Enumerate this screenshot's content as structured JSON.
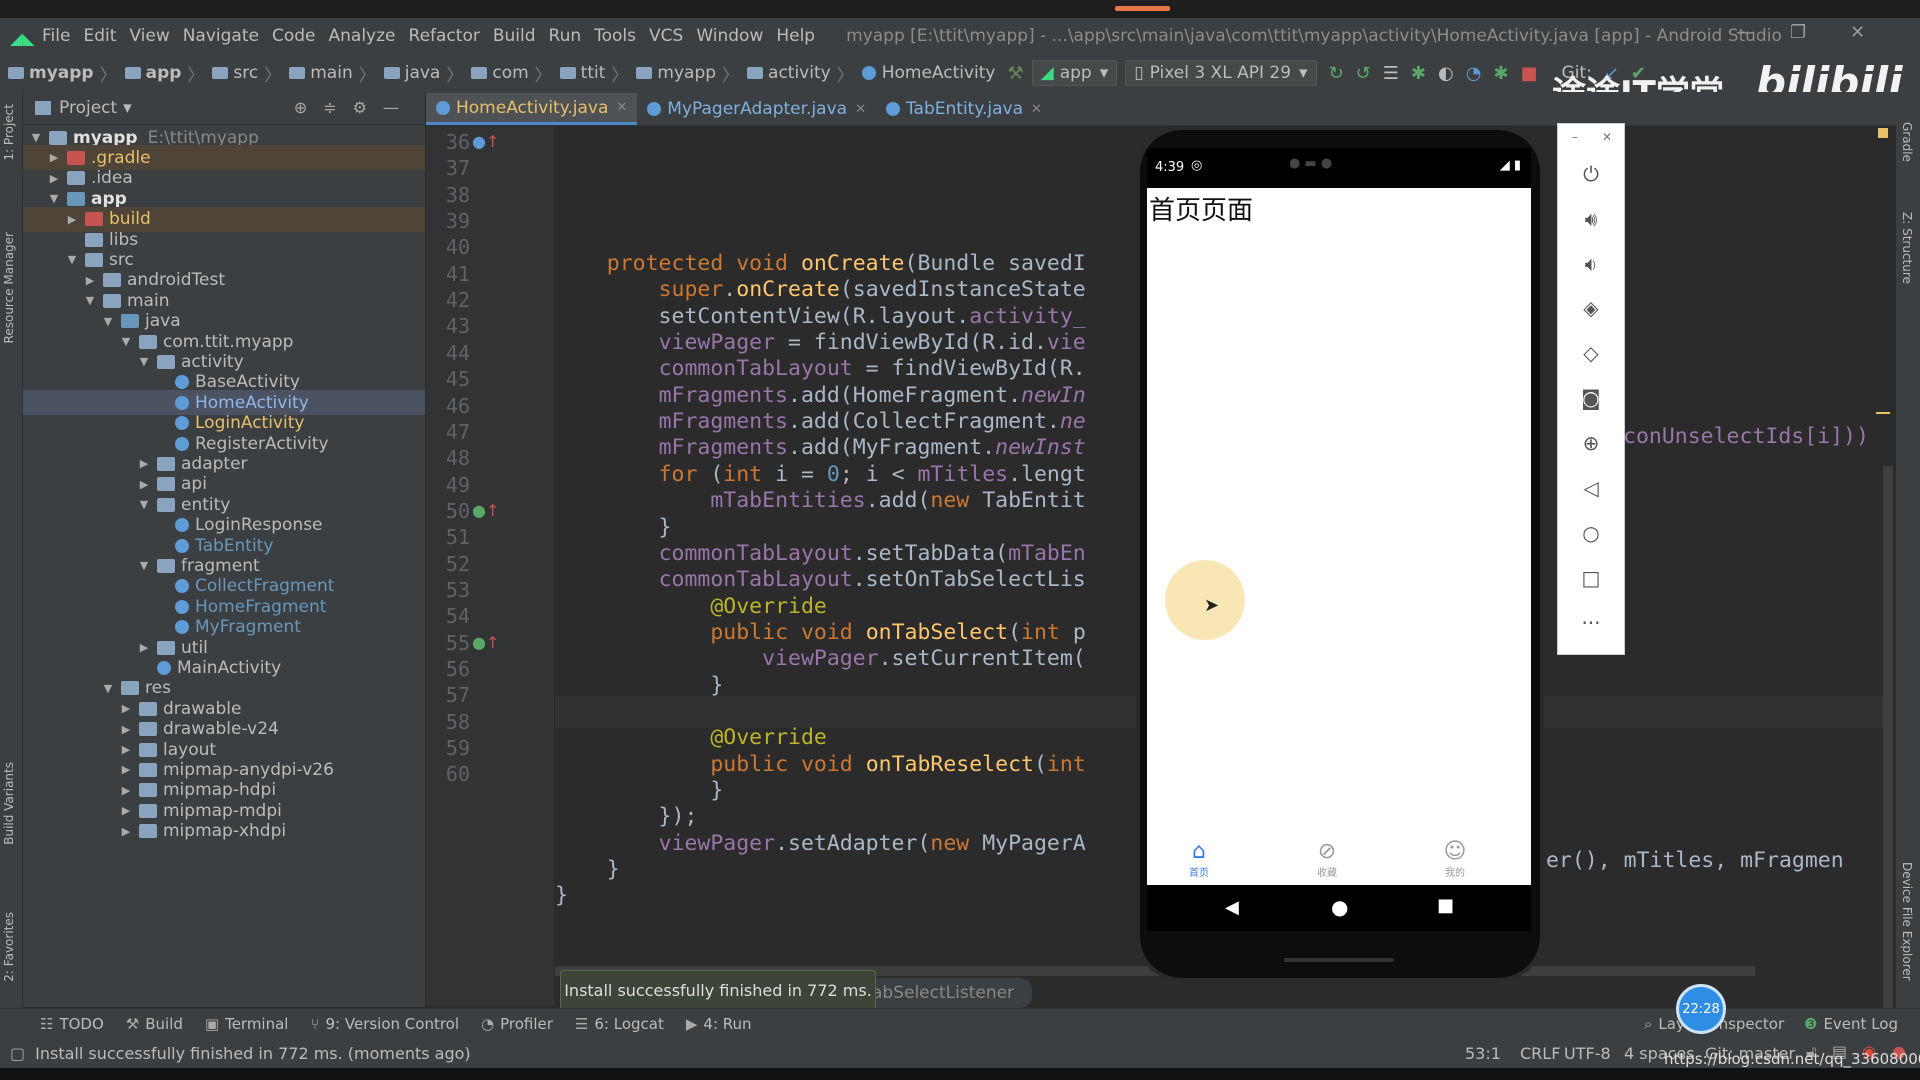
{
  "menubar": {
    "items": [
      "File",
      "Edit",
      "View",
      "Navigate",
      "Code",
      "Analyze",
      "Refactor",
      "Build",
      "Run",
      "Tools",
      "VCS",
      "Window",
      "Help"
    ],
    "window_title": "myapp [E:\\ttit\\myapp] - ...\\app\\src\\main\\java\\com\\ttit\\myapp\\activity\\HomeActivity.java [app] - Android Studio"
  },
  "navbar": {
    "crumbs": [
      "myapp",
      "app",
      "src",
      "main",
      "java",
      "com",
      "ttit",
      "myapp",
      "activity"
    ],
    "current": "HomeActivity",
    "run_config": "app",
    "device": "Pixel 3 XL API 29",
    "git_label": "Git:"
  },
  "watermark": {
    "text": "途途IT学堂",
    "logo": "bilibili"
  },
  "project_panel": {
    "title": "Project",
    "tree": [
      {
        "label": "myapp",
        "path": "E:\\ttit\\myapp",
        "arrow": "▼",
        "icon": "folder",
        "indent": 0,
        "style": "root"
      },
      {
        "label": ".gradle",
        "arrow": "▶",
        "icon": "folder-red",
        "indent": 1,
        "style": "excluded"
      },
      {
        "label": ".idea",
        "arrow": "▶",
        "icon": "folder",
        "indent": 1,
        "style": "normal"
      },
      {
        "label": "app",
        "arrow": "▼",
        "icon": "folder-module",
        "indent": 1,
        "style": "bold"
      },
      {
        "label": "build",
        "arrow": "▶",
        "icon": "folder-red",
        "indent": 2,
        "style": "excluded"
      },
      {
        "label": "libs",
        "arrow": "",
        "icon": "folder",
        "indent": 2,
        "style": "normal"
      },
      {
        "label": "src",
        "arrow": "▼",
        "icon": "folder",
        "indent": 2,
        "style": "normal"
      },
      {
        "label": "androidTest",
        "arrow": "▶",
        "icon": "folder",
        "indent": 3,
        "style": "normal"
      },
      {
        "label": "main",
        "arrow": "▼",
        "icon": "folder",
        "indent": 3,
        "style": "normal"
      },
      {
        "label": "java",
        "arrow": "▼",
        "icon": "folder-blue",
        "indent": 4,
        "style": "normal"
      },
      {
        "label": "com.ttit.myapp",
        "arrow": "▼",
        "icon": "folder",
        "indent": 5,
        "style": "normal"
      },
      {
        "label": "activity",
        "arrow": "▼",
        "icon": "folder",
        "indent": 6,
        "style": "normal"
      },
      {
        "label": "BaseActivity",
        "arrow": "",
        "icon": "class",
        "indent": 7,
        "style": "normal"
      },
      {
        "label": "HomeActivity",
        "arrow": "",
        "icon": "class",
        "indent": 7,
        "style": "selected"
      },
      {
        "label": "LoginActivity",
        "arrow": "",
        "icon": "class",
        "indent": 7,
        "style": "modified"
      },
      {
        "label": "RegisterActivity",
        "arrow": "",
        "icon": "class",
        "indent": 7,
        "style": "normal"
      },
      {
        "label": "adapter",
        "arrow": "▶",
        "icon": "folder",
        "indent": 6,
        "style": "normal"
      },
      {
        "label": "api",
        "arrow": "▶",
        "icon": "folder",
        "indent": 6,
        "style": "normal"
      },
      {
        "label": "entity",
        "arrow": "▼",
        "icon": "folder",
        "indent": 6,
        "style": "normal"
      },
      {
        "label": "LoginResponse",
        "arrow": "",
        "icon": "class",
        "indent": 7,
        "style": "normal"
      },
      {
        "label": "TabEntity",
        "arrow": "",
        "icon": "class",
        "indent": 7,
        "style": "new"
      },
      {
        "label": "fragment",
        "arrow": "▼",
        "icon": "folder",
        "indent": 6,
        "style": "normal"
      },
      {
        "label": "CollectFragment",
        "arrow": "",
        "icon": "class",
        "indent": 7,
        "style": "new"
      },
      {
        "label": "HomeFragment",
        "arrow": "",
        "icon": "class",
        "indent": 7,
        "style": "new"
      },
      {
        "label": "MyFragment",
        "arrow": "",
        "icon": "class",
        "indent": 7,
        "style": "new"
      },
      {
        "label": "util",
        "arrow": "▶",
        "icon": "folder",
        "indent": 6,
        "style": "normal"
      },
      {
        "label": "MainActivity",
        "arrow": "",
        "icon": "class",
        "indent": 6,
        "style": "normal"
      },
      {
        "label": "res",
        "arrow": "▼",
        "icon": "folder",
        "indent": 4,
        "style": "normal"
      },
      {
        "label": "drawable",
        "arrow": "▶",
        "icon": "folder",
        "indent": 5,
        "style": "normal"
      },
      {
        "label": "drawable-v24",
        "arrow": "▶",
        "icon": "folder",
        "indent": 5,
        "style": "normal"
      },
      {
        "label": "layout",
        "arrow": "▶",
        "icon": "folder",
        "indent": 5,
        "style": "normal"
      },
      {
        "label": "mipmap-anydpi-v26",
        "arrow": "▶",
        "icon": "folder",
        "indent": 5,
        "style": "normal"
      },
      {
        "label": "mipmap-hdpi",
        "arrow": "▶",
        "icon": "folder",
        "indent": 5,
        "style": "normal"
      },
      {
        "label": "mipmap-mdpi",
        "arrow": "▶",
        "icon": "folder",
        "indent": 5,
        "style": "normal"
      },
      {
        "label": "mipmap-xhdpi",
        "arrow": "▶",
        "icon": "folder",
        "indent": 5,
        "style": "normal"
      }
    ]
  },
  "editor": {
    "tabs": [
      {
        "label": "HomeActivity.java",
        "active": true
      },
      {
        "label": "MyPagerAdapter.java",
        "active": false
      },
      {
        "label": "TabEntity.java",
        "active": false
      }
    ],
    "current_line": 53,
    "lines": [
      {
        "n": 36,
        "mark": "o↑",
        "tokens": [
          [
            "    ",
            ""
          ],
          [
            "protected void ",
            "kw"
          ],
          [
            "onCreate",
            "fn"
          ],
          [
            "(Bundle savedI",
            ""
          ]
        ]
      },
      {
        "n": 37,
        "mark": "",
        "tokens": [
          [
            "        ",
            ""
          ],
          [
            "super",
            "kw"
          ],
          [
            ".",
            ""
          ],
          [
            "onCreate",
            "fn"
          ],
          [
            "(savedInstanceState",
            ""
          ]
        ]
      },
      {
        "n": 38,
        "mark": "",
        "tokens": [
          [
            "        setContentView(R.layout.",
            ""
          ],
          [
            "activity_",
            "fld"
          ]
        ]
      },
      {
        "n": 39,
        "mark": "",
        "tokens": [
          [
            "        ",
            ""
          ],
          [
            "viewPager",
            "fld"
          ],
          [
            " = findViewById(R.id.",
            ""
          ],
          [
            "vie",
            "fld"
          ]
        ]
      },
      {
        "n": 40,
        "mark": "",
        "tokens": [
          [
            "        ",
            ""
          ],
          [
            "commonTabLayout",
            "fld"
          ],
          [
            " = findViewById(R.",
            ""
          ]
        ]
      },
      {
        "n": 41,
        "mark": "",
        "tokens": [
          [
            "        ",
            ""
          ],
          [
            "mFragments",
            "fld"
          ],
          [
            ".add(HomeFragment.",
            ""
          ],
          [
            "newIn",
            "st"
          ]
        ]
      },
      {
        "n": 42,
        "mark": "",
        "tokens": [
          [
            "        ",
            ""
          ],
          [
            "mFragments",
            "fld"
          ],
          [
            ".add(CollectFragment.",
            ""
          ],
          [
            "ne",
            "st"
          ]
        ]
      },
      {
        "n": 43,
        "mark": "",
        "tokens": [
          [
            "        ",
            ""
          ],
          [
            "mFragments",
            "fld"
          ],
          [
            ".add(MyFragment.",
            ""
          ],
          [
            "newInst",
            "st"
          ]
        ]
      },
      {
        "n": 44,
        "mark": "",
        "tokens": [
          [
            "        ",
            ""
          ],
          [
            "for ",
            "kw"
          ],
          [
            "(",
            ""
          ],
          [
            "int ",
            "kw"
          ],
          [
            "i = ",
            ""
          ],
          [
            "0",
            "num"
          ],
          [
            "; i < ",
            ""
          ],
          [
            "mTitles",
            "fld"
          ],
          [
            ".lengt",
            ""
          ]
        ]
      },
      {
        "n": 45,
        "mark": "",
        "tokens": [
          [
            "            ",
            ""
          ],
          [
            "mTabEntities",
            "fld"
          ],
          [
            ".add(",
            ""
          ],
          [
            "new ",
            "kw"
          ],
          [
            "TabEntit",
            ""
          ]
        ]
      },
      {
        "n": 46,
        "mark": "",
        "tokens": [
          [
            "        }",
            ""
          ]
        ]
      },
      {
        "n": 47,
        "mark": "",
        "tokens": [
          [
            "        ",
            ""
          ],
          [
            "commonTabLayout",
            "fld"
          ],
          [
            ".setTabData(",
            ""
          ],
          [
            "mTabEn",
            "fld"
          ]
        ]
      },
      {
        "n": 48,
        "mark": "",
        "tokens": [
          [
            "        ",
            ""
          ],
          [
            "commonTabLayout",
            "fld"
          ],
          [
            ".setOnTabSelectLis",
            ""
          ]
        ]
      },
      {
        "n": 49,
        "mark": "",
        "tokens": [
          [
            "            ",
            ""
          ],
          [
            "@Override",
            "ann"
          ]
        ]
      },
      {
        "n": 50,
        "mark": "i↑",
        "tokens": [
          [
            "            ",
            ""
          ],
          [
            "public void ",
            "kw"
          ],
          [
            "onTabSelect",
            "fn"
          ],
          [
            "(",
            ""
          ],
          [
            "int ",
            "kw"
          ],
          [
            "p",
            ""
          ]
        ]
      },
      {
        "n": 51,
        "mark": "",
        "tokens": [
          [
            "                ",
            ""
          ],
          [
            "viewPager",
            "fld"
          ],
          [
            ".setCurrentItem(",
            ""
          ]
        ]
      },
      {
        "n": 52,
        "mark": "",
        "tokens": [
          [
            "            }",
            ""
          ]
        ]
      },
      {
        "n": 53,
        "mark": "",
        "tokens": [
          [
            "",
            ""
          ]
        ]
      },
      {
        "n": 54,
        "mark": "",
        "tokens": [
          [
            "            ",
            ""
          ],
          [
            "@Override",
            "ann"
          ]
        ]
      },
      {
        "n": 55,
        "mark": "i↑",
        "tokens": [
          [
            "            ",
            ""
          ],
          [
            "public void ",
            "kw"
          ],
          [
            "onTabReselect",
            "fn"
          ],
          [
            "(",
            ""
          ],
          [
            "int",
            "kw"
          ]
        ]
      },
      {
        "n": 56,
        "mark": "",
        "tokens": [
          [
            "            }",
            ""
          ]
        ]
      },
      {
        "n": 57,
        "mark": "",
        "tokens": [
          [
            "        });",
            ""
          ]
        ]
      },
      {
        "n": 58,
        "mark": "",
        "tokens": [
          [
            "        ",
            ""
          ],
          [
            "viewPager",
            "fld"
          ],
          [
            ".setAdapter(",
            ""
          ],
          [
            "new ",
            "kw"
          ],
          [
            "MyPagerA",
            ""
          ]
        ]
      },
      {
        "n": 59,
        "mark": "",
        "tokens": [
          [
            "    }",
            ""
          ]
        ]
      },
      {
        "n": 60,
        "mark": "",
        "tokens": [
          [
            "}",
            ""
          ]
        ]
      }
    ],
    "overflow_line45": "conUnselectIds[i]))",
    "overflow_line58": "ger(), mTitles, mFragmen",
    "breadcrumb_overlay": "abSelectListener"
  },
  "emulator": {
    "time": "4:39",
    "page_text": "首页页面",
    "tabs": [
      {
        "label": "首页",
        "icon": "home-icon",
        "active": true
      },
      {
        "label": "收藏",
        "icon": "compass-icon",
        "active": false
      },
      {
        "label": "我的",
        "icon": "person-icon",
        "active": false
      }
    ],
    "controls": [
      "power-icon",
      "volume-up-icon",
      "volume-down-icon",
      "rotate-left-icon",
      "rotate-right-icon",
      "camera-icon",
      "zoom-icon",
      "back-icon",
      "home-icon",
      "overview-icon",
      "more-icon"
    ]
  },
  "toast": "Install successfully finished in 772 ms.",
  "tool_windows": [
    "TODO",
    "Build",
    "Terminal",
    "9: Version Control",
    "Profiler",
    "6: Logcat",
    "4: Run"
  ],
  "tool_windows_right": [
    "Layout Inspector",
    "Event Log"
  ],
  "timer_badge": "22:28",
  "status": {
    "message": "Install successfully finished in 772 ms. (moments ago)",
    "position": "53:1",
    "line_sep": "CRLF",
    "encoding": "UTF-8",
    "indent": "4 spaces",
    "git": "Git: master",
    "url": "https://blog.csdn.net/qq_33608000"
  },
  "side_tabs": {
    "left": [
      "1: Project",
      "Resource Manager",
      "Build Variants",
      "2: Favorites"
    ],
    "right": [
      "Gradle",
      "Z: Structure",
      "Device File Explorer"
    ]
  },
  "colors": {
    "accent": "#4a88c7",
    "emulator_tab_active": "#3d7be0",
    "touch_indicator": "#f7e3a8"
  }
}
